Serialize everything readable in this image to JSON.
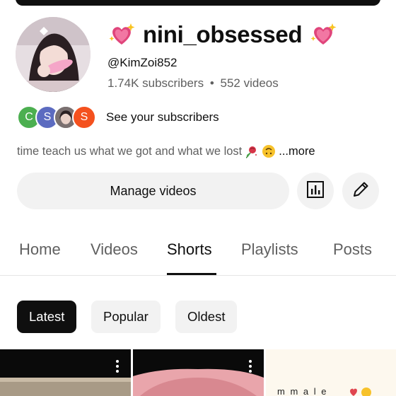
{
  "channel": {
    "name": "nini_obsessed",
    "handle": "@KimZoi852",
    "subscribers": "1.74K subscribers",
    "separator": "•",
    "videos": "552 videos"
  },
  "subscribers_preview": {
    "avatars": [
      "C",
      "S",
      "",
      "S"
    ],
    "link": "See your subscribers"
  },
  "description": {
    "text": "time teach us what we got and what we lost",
    "more": "...more"
  },
  "actions": {
    "manage_videos": "Manage videos"
  },
  "tabs": [
    {
      "label": "Home",
      "active": false
    },
    {
      "label": "Videos",
      "active": false
    },
    {
      "label": "Shorts",
      "active": true
    },
    {
      "label": "Playlists",
      "active": false
    },
    {
      "label": "Posts",
      "active": false
    }
  ],
  "chips": [
    {
      "label": "Latest",
      "active": true
    },
    {
      "label": "Popular",
      "active": false
    },
    {
      "label": "Oldest",
      "active": false
    }
  ],
  "shorts_grid": {
    "third_card_text": "m m a l e"
  },
  "colors": {
    "text": "#0f0f0f",
    "secondary_text": "#606060",
    "chip_bg": "#f2f2f2",
    "active_chip_bg": "#0f0f0f",
    "sparkle_heart": "#e0457b"
  },
  "icons": [
    "sparkling-heart-icon",
    "rose-icon",
    "upside-down-face-icon",
    "analytics-icon",
    "pencil-icon",
    "more-vertical-icon"
  ]
}
